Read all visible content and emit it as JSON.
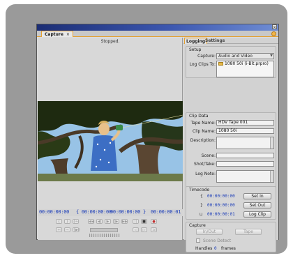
{
  "window": {
    "close_glyph": "×"
  },
  "tab": {
    "label": "Capture",
    "close_glyph": "×"
  },
  "viewer": {
    "status": "Stopped.",
    "timecode_current": "00:00:00:00",
    "timecode_in": "{ 00:00:00:00",
    "timecode_out": "00:00:00:00 }",
    "timecode_duration": "00:00:00:01"
  },
  "panel_tabs": {
    "logging": "Logging",
    "settings": "Settings"
  },
  "setup": {
    "title": "Setup",
    "capture_label": "Capture:",
    "capture_value": "Audio and Video",
    "log_clips_label": "Log Clips To:",
    "log_clips_value": "1080 50i (i-Bit.prpro)"
  },
  "clip_data": {
    "title": "Clip Data",
    "tape_name_label": "Tape Name:",
    "tape_name_value": "HDV Tape 001",
    "clip_name_label": "Clip Name:",
    "clip_name_value": "1080 50i",
    "description_label": "Description:",
    "scene_label": "Scene:",
    "shot_take_label": "Shot/Take:",
    "log_note_label": "Log Note:"
  },
  "timecode": {
    "title": "Timecode",
    "in_value": "00:00:00:00",
    "out_value": "00:00:00:00",
    "dur_value": "00:00:00:01",
    "set_in_label": "Set In",
    "set_out_label": "Set Out",
    "log_clip_label": "Log Clip"
  },
  "capture": {
    "title": "Capture",
    "in_out_label": "In/Out",
    "tape_label": "Tape",
    "scene_detect_label": "Scene Detect",
    "handles_label": "Handles",
    "handles_value": "0",
    "frames_label": "frames"
  },
  "colors": {
    "accent": "#e4a030",
    "timecode": "#1a3cb8",
    "titlebar": "#1b2d74"
  }
}
